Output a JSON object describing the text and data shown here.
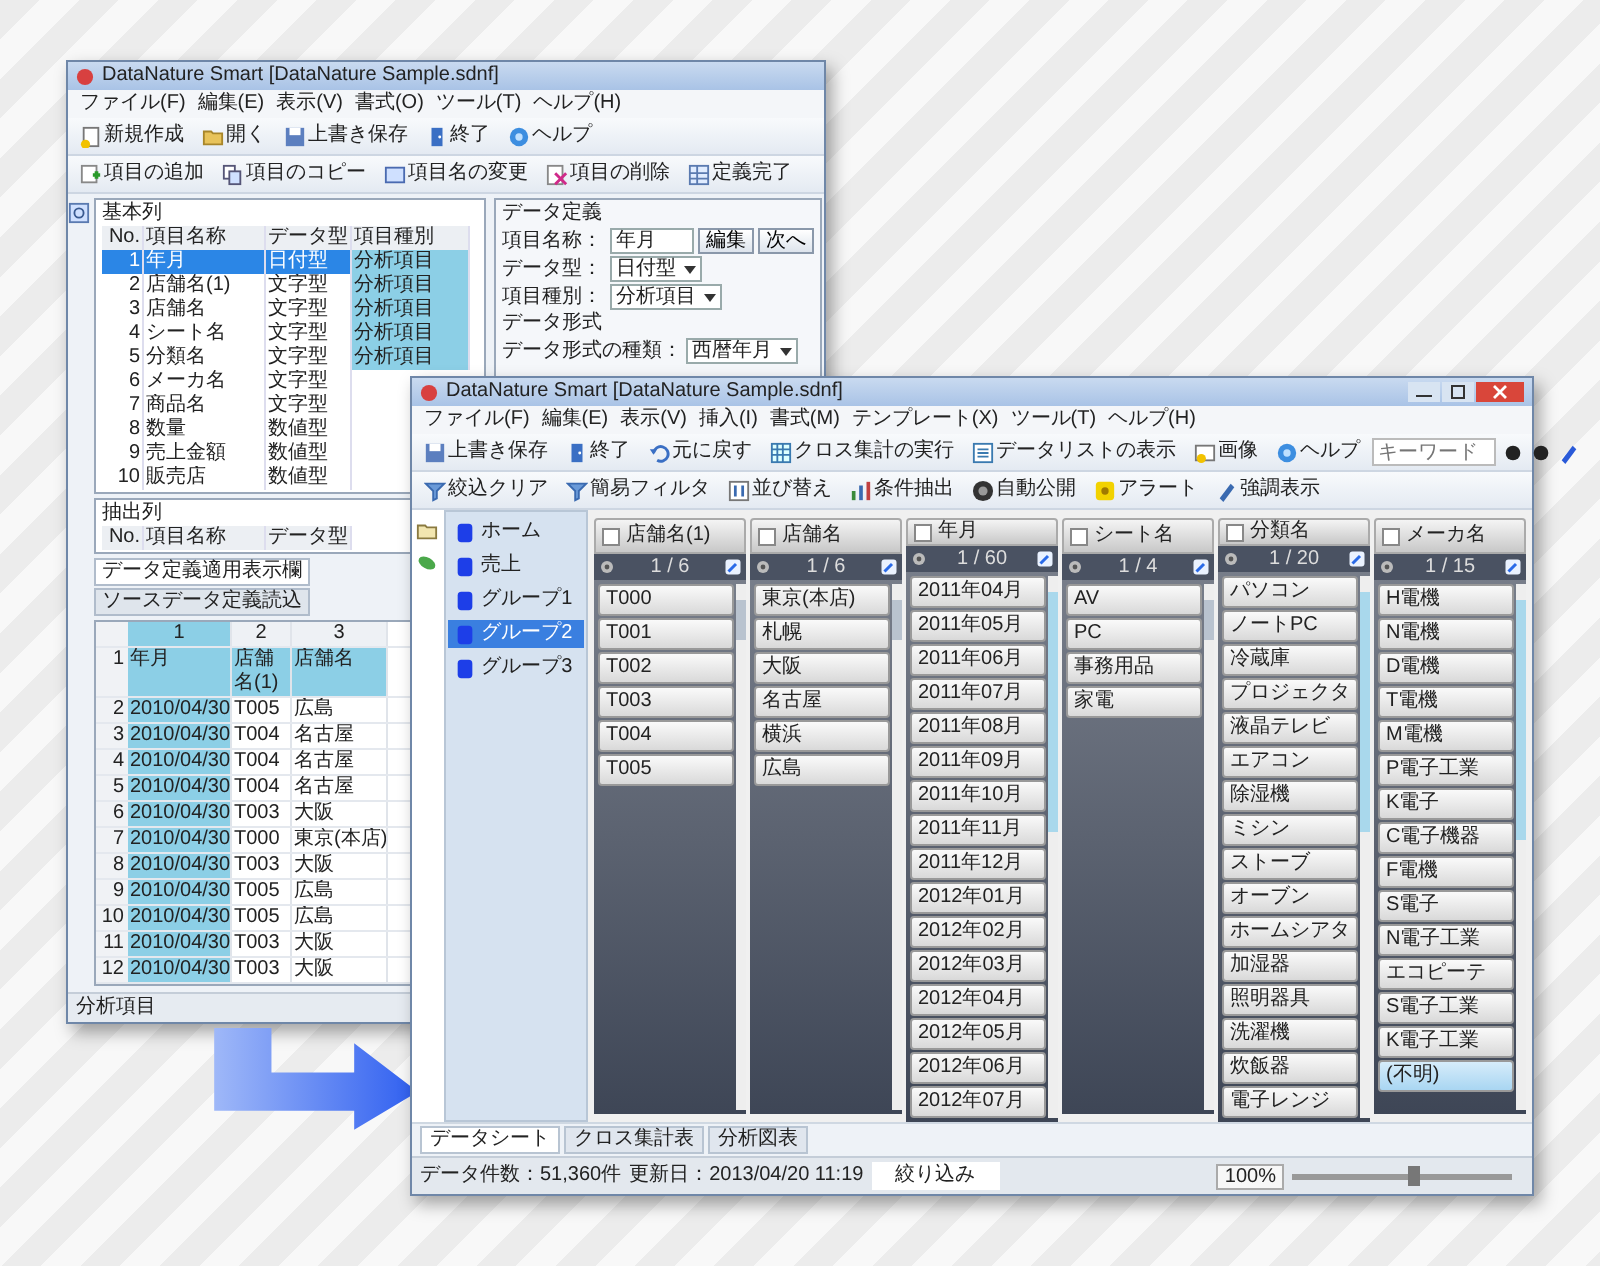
{
  "back_window": {
    "title": "DataNature Smart [DataNature Sample.sdnf]",
    "menu": [
      "ファイル(F)",
      "編集(E)",
      "表示(V)",
      "書式(O)",
      "ツール(T)",
      "ヘルプ(H)"
    ],
    "toolbar_1": [
      {
        "kind": "new",
        "label": "新規作成"
      },
      {
        "kind": "open",
        "label": "開く"
      },
      {
        "kind": "save",
        "label": "上書き保存"
      },
      {
        "kind": "exit",
        "label": "終了"
      },
      {
        "kind": "help",
        "label": "ヘルプ"
      }
    ],
    "toolbar_2": [
      {
        "kind": "add",
        "label": "項目の追加"
      },
      {
        "kind": "copy",
        "label": "項目のコピー"
      },
      {
        "kind": "rename",
        "label": "項目名の変更"
      },
      {
        "kind": "delete",
        "label": "項目の削除"
      },
      {
        "kind": "done",
        "label": "定義完了"
      }
    ],
    "base_panel": {
      "title": "基本列",
      "columns": [
        "No.",
        "項目名称",
        "データ型",
        "項目種別"
      ],
      "rows": [
        {
          "cells": [
            "1",
            "年月",
            "日付型",
            "分析項目"
          ],
          "selected": true
        },
        {
          "cells": [
            "2",
            "店舗名(1)",
            "文字型",
            "分析項目"
          ],
          "selected": false
        },
        {
          "cells": [
            "3",
            "店舗名",
            "文字型",
            "分析項目"
          ],
          "selected": false
        },
        {
          "cells": [
            "4",
            "シート名",
            "文字型",
            "分析項目"
          ],
          "selected": false
        },
        {
          "cells": [
            "5",
            "分類名",
            "文字型",
            "分析項目"
          ],
          "selected": false
        },
        {
          "cells": [
            "6",
            "メーカ名",
            "文字型"
          ],
          "selected": false
        },
        {
          "cells": [
            "7",
            "商品名",
            "文字型"
          ],
          "selected": false
        },
        {
          "cells": [
            "8",
            "数量",
            "数値型"
          ],
          "selected": false
        },
        {
          "cells": [
            "9",
            "売上金額",
            "数値型"
          ],
          "selected": false
        },
        {
          "cells": [
            "10",
            "販売店",
            "数値型"
          ],
          "selected": false
        }
      ]
    },
    "definition_panel": {
      "title": "データ定義",
      "name_label": "項目名称：",
      "name_value": "年月",
      "buttons": [
        "編集",
        "次へ"
      ],
      "selects": [
        {
          "label": "データ型：",
          "value": "日付型"
        },
        {
          "label": "項目種別：",
          "value": "分析項目"
        }
      ],
      "format_title": "データ形式",
      "format_selects": [
        {
          "label": "データ形式の種類：",
          "value": "西暦年月"
        }
      ]
    },
    "extract_panel": {
      "title": "抽出列",
      "columns": [
        "No.",
        "項目名称",
        "データ型"
      ]
    },
    "grid_tabs": [
      {
        "label": "データ定義適用表示欄",
        "selected": true
      },
      {
        "label": "ソースデータ定義読込",
        "selected": false
      }
    ],
    "grid": {
      "columns": [
        "1",
        "2",
        "3"
      ],
      "rows": [
        {
          "number": "1",
          "cells": [
            "年月",
            "店舗名(1)",
            "店舗名"
          ]
        },
        {
          "number": "2",
          "cells": [
            "2010/04/30",
            "T005",
            "広島"
          ]
        },
        {
          "number": "3",
          "cells": [
            "2010/04/30",
            "T004",
            "名古屋"
          ]
        },
        {
          "number": "4",
          "cells": [
            "2010/04/30",
            "T004",
            "名古屋"
          ]
        },
        {
          "number": "5",
          "cells": [
            "2010/04/30",
            "T004",
            "名古屋"
          ]
        },
        {
          "number": "6",
          "cells": [
            "2010/04/30",
            "T003",
            "大阪"
          ]
        },
        {
          "number": "7",
          "cells": [
            "2010/04/30",
            "T000",
            "東京(本店)"
          ]
        },
        {
          "number": "8",
          "cells": [
            "2010/04/30",
            "T003",
            "大阪"
          ]
        },
        {
          "number": "9",
          "cells": [
            "2010/04/30",
            "T005",
            "広島"
          ]
        },
        {
          "number": "10",
          "cells": [
            "2010/04/30",
            "T005",
            "広島"
          ]
        },
        {
          "number": "11",
          "cells": [
            "2010/04/30",
            "T003",
            "大阪"
          ]
        },
        {
          "number": "12",
          "cells": [
            "2010/04/30",
            "T003",
            "大阪"
          ]
        }
      ]
    },
    "status": "分析項目"
  },
  "front_window": {
    "title": "DataNature Smart [DataNature Sample.sdnf]",
    "menu": [
      "ファイル(F)",
      "編集(E)",
      "表示(V)",
      "挿入(I)",
      "書式(M)",
      "テンプレート(X)",
      "ツール(T)",
      "ヘルプ(H)"
    ],
    "toolbar_1": [
      {
        "kind": "save",
        "label": "上書き保存"
      },
      {
        "kind": "exit",
        "label": "終了"
      },
      {
        "kind": "undo",
        "label": "元に戻す"
      },
      {
        "kind": "cross",
        "label": "クロス集計の実行"
      },
      {
        "kind": "list",
        "label": "データリストの表示"
      },
      {
        "kind": "image",
        "label": "画像"
      },
      {
        "kind": "help",
        "label": "ヘルプ"
      }
    ],
    "search": {
      "placeholder": "キーワード"
    },
    "toolbar_2": [
      {
        "kind": "clear",
        "label": "絞込クリア"
      },
      {
        "kind": "filter",
        "label": "簡易フィルタ"
      },
      {
        "kind": "sort",
        "label": "並び替え"
      },
      {
        "kind": "extract",
        "label": "条件抽出"
      },
      {
        "kind": "publish",
        "label": "自動公開"
      },
      {
        "kind": "alert",
        "label": "アラート"
      },
      {
        "kind": "highlight",
        "label": "強調表示"
      }
    ],
    "tree": [
      {
        "label": "ホーム",
        "selected": false
      },
      {
        "label": "売上",
        "selected": false
      },
      {
        "label": "グループ1",
        "selected": false
      },
      {
        "label": "グループ2",
        "selected": true
      },
      {
        "label": "グループ3",
        "selected": false
      }
    ],
    "columns": [
      {
        "title": "店舗名(1)",
        "checked": false,
        "counter": "1 / 6",
        "items": [
          {
            "label": "T000",
            "selected": false
          },
          {
            "label": "T001",
            "selected": false
          },
          {
            "label": "T002",
            "selected": false
          },
          {
            "label": "T003",
            "selected": false
          },
          {
            "label": "T004",
            "selected": false
          },
          {
            "label": "T005",
            "selected": false
          }
        ]
      },
      {
        "title": "店舗名",
        "checked": false,
        "counter": "1 / 6",
        "items": [
          {
            "label": "東京(本店)",
            "selected": false
          },
          {
            "label": "札幌",
            "selected": false
          },
          {
            "label": "大阪",
            "selected": false
          },
          {
            "label": "名古屋",
            "selected": false
          },
          {
            "label": "横浜",
            "selected": false
          },
          {
            "label": "広島",
            "selected": false
          }
        ]
      },
      {
        "title": "年月",
        "checked": false,
        "counter": "1 / 60",
        "items": [
          {
            "label": "2011年04月",
            "selected": false
          },
          {
            "label": "2011年05月",
            "selected": false
          },
          {
            "label": "2011年06月",
            "selected": false
          },
          {
            "label": "2011年07月",
            "selected": false
          },
          {
            "label": "2011年08月",
            "selected": false
          },
          {
            "label": "2011年09月",
            "selected": false
          },
          {
            "label": "2011年10月",
            "selected": false
          },
          {
            "label": "2011年11月",
            "selected": false
          },
          {
            "label": "2011年12月",
            "selected": false
          },
          {
            "label": "2012年01月",
            "selected": false
          },
          {
            "label": "2012年02月",
            "selected": false
          },
          {
            "label": "2012年03月",
            "selected": false
          },
          {
            "label": "2012年04月",
            "selected": false
          },
          {
            "label": "2012年05月",
            "selected": false
          },
          {
            "label": "2012年06月",
            "selected": false
          },
          {
            "label": "2012年07月",
            "selected": false
          }
        ]
      },
      {
        "title": "シート名",
        "checked": false,
        "counter": "1 / 4",
        "items": [
          {
            "label": "AV",
            "selected": false
          },
          {
            "label": "PC",
            "selected": false
          },
          {
            "label": "事務用品",
            "selected": false
          },
          {
            "label": "家電",
            "selected": false
          }
        ]
      },
      {
        "title": "分類名",
        "checked": false,
        "counter": "1 / 20",
        "items": [
          {
            "label": "パソコン",
            "selected": false
          },
          {
            "label": "ノートPC",
            "selected": false
          },
          {
            "label": "冷蔵庫",
            "selected": false
          },
          {
            "label": "プロジェクタ",
            "selected": false
          },
          {
            "label": "液晶テレビ",
            "selected": false
          },
          {
            "label": "エアコン",
            "selected": false
          },
          {
            "label": "除湿機",
            "selected": false
          },
          {
            "label": "ミシン",
            "selected": false
          },
          {
            "label": "ストーブ",
            "selected": false
          },
          {
            "label": "オーブン",
            "selected": false
          },
          {
            "label": "ホームシアタ",
            "selected": false
          },
          {
            "label": "加湿器",
            "selected": false
          },
          {
            "label": "照明器具",
            "selected": false
          },
          {
            "label": "洗濯機",
            "selected": false
          },
          {
            "label": "炊飯器",
            "selected": false
          },
          {
            "label": "電子レンジ",
            "selected": false
          }
        ]
      },
      {
        "title": "メーカ名",
        "checked": false,
        "counter": "1 / 15",
        "items": [
          {
            "label": "H電機",
            "selected": false
          },
          {
            "label": "N電機",
            "selected": false
          },
          {
            "label": "D電機",
            "selected": false
          },
          {
            "label": "T電機",
            "selected": false
          },
          {
            "label": "M電機",
            "selected": false
          },
          {
            "label": "P電子工業",
            "selected": false
          },
          {
            "label": "K電子",
            "selected": false
          },
          {
            "label": "C電子機器",
            "selected": false
          },
          {
            "label": "F電機",
            "selected": false
          },
          {
            "label": "S電子",
            "selected": false
          },
          {
            "label": "N電子工業",
            "selected": false
          },
          {
            "label": "エコピーテ",
            "selected": false
          },
          {
            "label": "S電子工業",
            "selected": false
          },
          {
            "label": "K電子工業",
            "selected": false
          },
          {
            "label": "(不明)",
            "selected": true
          }
        ]
      }
    ],
    "sheet_tabs": [
      {
        "label": "データシート",
        "selected": true
      },
      {
        "label": "クロス集計表",
        "selected": false
      },
      {
        "label": "分析図表",
        "selected": false
      }
    ],
    "status": {
      "count": "データ件数：51,360件",
      "updated": "更新日：2013/04/20 11:19",
      "filter": "絞り込み",
      "zoom": "100%",
      "zoom_slider": {
        "level": 0.55
      }
    }
  }
}
